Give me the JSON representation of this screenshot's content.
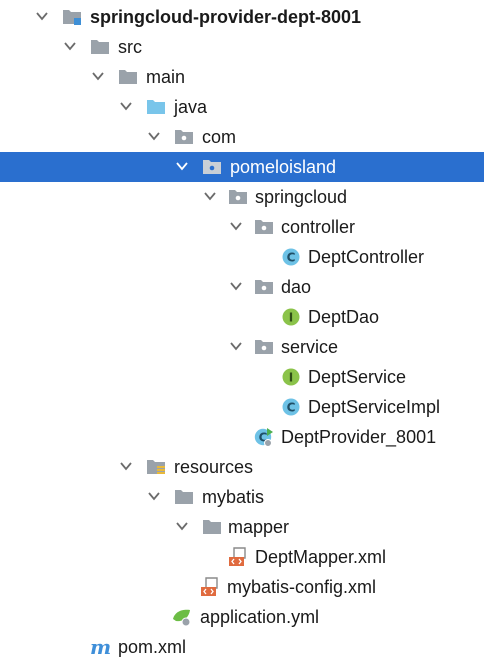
{
  "colors": {
    "selection": "#2a6fcf",
    "folder": "#9aa2aa",
    "source_folder": "#79c5ea",
    "class_icon": "#6ec2e6",
    "interface_icon": "#8bc34a",
    "xml_accent": "#e06b3f",
    "spring_leaf": "#6cbd45",
    "maven_m": "#3f8fd9"
  },
  "tree": {
    "items": [
      {
        "label": "springcloud-provider-dept-8001",
        "icon": "module-folder-icon",
        "expanded": true,
        "bold": true
      },
      {
        "label": "src",
        "icon": "folder-icon",
        "expanded": true
      },
      {
        "label": "main",
        "icon": "folder-icon",
        "expanded": true
      },
      {
        "label": "java",
        "icon": "source-folder-icon",
        "expanded": true
      },
      {
        "label": "com",
        "icon": "package-icon",
        "expanded": true
      },
      {
        "label": "pomeloisland",
        "icon": "package-icon",
        "expanded": true,
        "selected": true
      },
      {
        "label": "springcloud",
        "icon": "package-icon",
        "expanded": true
      },
      {
        "label": "controller",
        "icon": "package-icon",
        "expanded": true
      },
      {
        "label": "DeptController",
        "icon": "class-icon",
        "badge": "C"
      },
      {
        "label": "dao",
        "icon": "package-icon",
        "expanded": true
      },
      {
        "label": "DeptDao",
        "icon": "interface-icon",
        "badge": "I"
      },
      {
        "label": "service",
        "icon": "package-icon",
        "expanded": true
      },
      {
        "label": "DeptService",
        "icon": "interface-icon",
        "badge": "I"
      },
      {
        "label": "DeptServiceImpl",
        "icon": "class-icon",
        "badge": "C"
      },
      {
        "label": "DeptProvider_8001",
        "icon": "spring-boot-class-icon",
        "badge": "C"
      },
      {
        "label": "resources",
        "icon": "resources-folder-icon",
        "expanded": true
      },
      {
        "label": "mybatis",
        "icon": "folder-icon",
        "expanded": true
      },
      {
        "label": "mapper",
        "icon": "folder-icon",
        "expanded": true
      },
      {
        "label": "DeptMapper.xml",
        "icon": "xml-file-icon"
      },
      {
        "label": "mybatis-config.xml",
        "icon": "xml-file-icon"
      },
      {
        "label": "application.yml",
        "icon": "spring-yml-icon"
      },
      {
        "label": "pom.xml",
        "icon": "maven-icon",
        "badge": "m"
      }
    ]
  }
}
